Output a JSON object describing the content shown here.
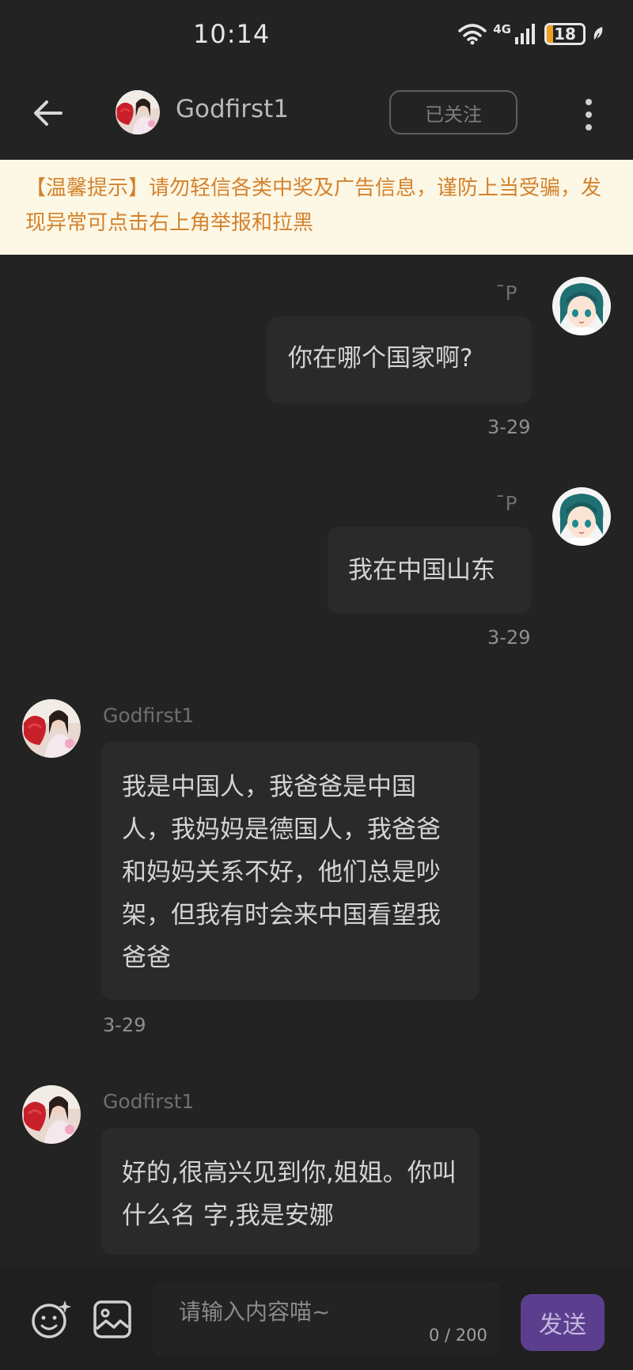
{
  "status_bar": {
    "time": "10:14",
    "network": "4G",
    "battery": "18",
    "battery_level_percent": 18
  },
  "header": {
    "contact_name": "Godfirst1",
    "follow_label": "已关注",
    "back_icon": "arrow-left-icon",
    "more_icon": "more-vertical-icon"
  },
  "notice": {
    "text": "【温馨提示】请勿轻信各类中奖及广告信息，谨防上当受骗，发现异常可点击右上角举报和拉黑"
  },
  "messages": [
    {
      "side": "right",
      "sender": "¯P",
      "text": "你在哪个国家啊?",
      "time": "3-29"
    },
    {
      "side": "right",
      "sender": "¯P",
      "text": "我在中国山东",
      "time": "3-29"
    },
    {
      "side": "left",
      "sender": "Godfirst1",
      "text": "我是中国人，我爸爸是中国人，我妈妈是德国人，我爸爸和妈妈关系不好，他们总是吵架，但我有时会来中国看望我爸爸",
      "time": "3-29"
    },
    {
      "side": "left",
      "sender": "Godfirst1",
      "text": "好的,很高兴见到你,姐姐。你叫什么名 字,我是安娜"
    }
  ],
  "input": {
    "placeholder": "请输入内容喵~",
    "value": "",
    "char_count": "0 / 200",
    "send_label": "发送"
  },
  "colors": {
    "background": "#232323",
    "bubble": "#2a2a2a",
    "notice_bg": "#fdf8e6",
    "notice_text": "#d4822e",
    "send_button": "#5b3f8e"
  }
}
